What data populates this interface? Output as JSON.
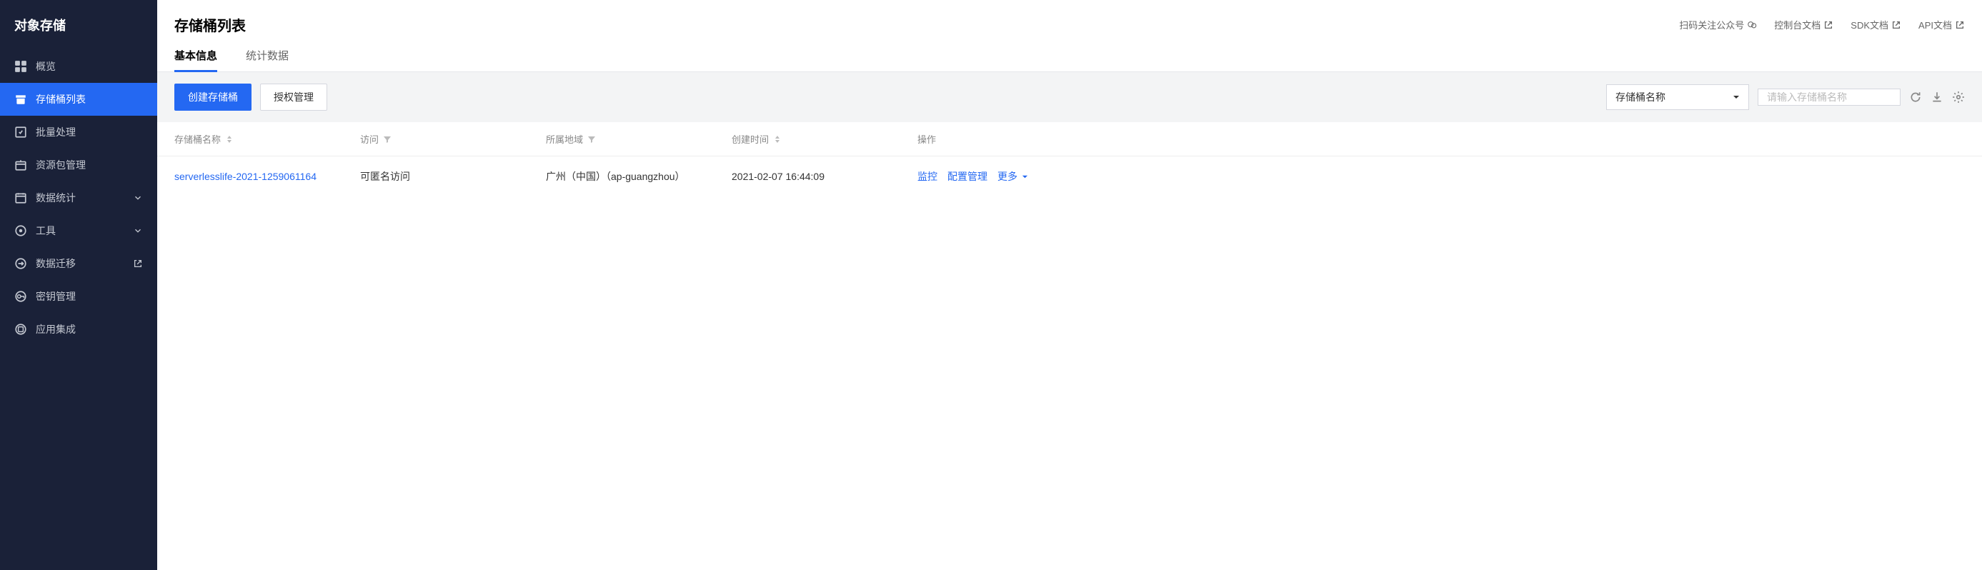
{
  "sidebar": {
    "title": "对象存储",
    "items": [
      {
        "label": "概览",
        "icon": "grid"
      },
      {
        "label": "存储桶列表",
        "icon": "bucket",
        "active": true
      },
      {
        "label": "批量处理",
        "icon": "batch"
      },
      {
        "label": "资源包管理",
        "icon": "package"
      },
      {
        "label": "数据统计",
        "icon": "stats",
        "expandable": true
      },
      {
        "label": "工具",
        "icon": "tool",
        "expandable": true
      },
      {
        "label": "数据迁移",
        "icon": "migrate",
        "external": true
      },
      {
        "label": "密钥管理",
        "icon": "key"
      },
      {
        "label": "应用集成",
        "icon": "app"
      }
    ]
  },
  "header": {
    "title": "存储桶列表",
    "links": [
      {
        "label": "扫码关注公众号",
        "icon": "wechat"
      },
      {
        "label": "控制台文档",
        "icon": "external"
      },
      {
        "label": "SDK文档",
        "icon": "external"
      },
      {
        "label": "API文档",
        "icon": "external"
      }
    ]
  },
  "tabs": [
    {
      "label": "基本信息",
      "active": true
    },
    {
      "label": "统计数据"
    }
  ],
  "toolbar": {
    "create_label": "创建存储桶",
    "auth_label": "授权管理",
    "select_value": "存储桶名称",
    "search_placeholder": "请输入存储桶名称"
  },
  "table": {
    "columns": {
      "name": "存储桶名称",
      "access": "访问",
      "region": "所属地域",
      "created": "创建时间",
      "action": "操作"
    },
    "rows": [
      {
        "name": "serverlesslife-2021-1259061164",
        "access": "可匿名访问",
        "region": "广州（中国）（ap-guangzhou）",
        "created": "2021-02-07 16:44:09",
        "actions": {
          "monitor": "监控",
          "config": "配置管理",
          "more": "更多"
        }
      }
    ]
  }
}
